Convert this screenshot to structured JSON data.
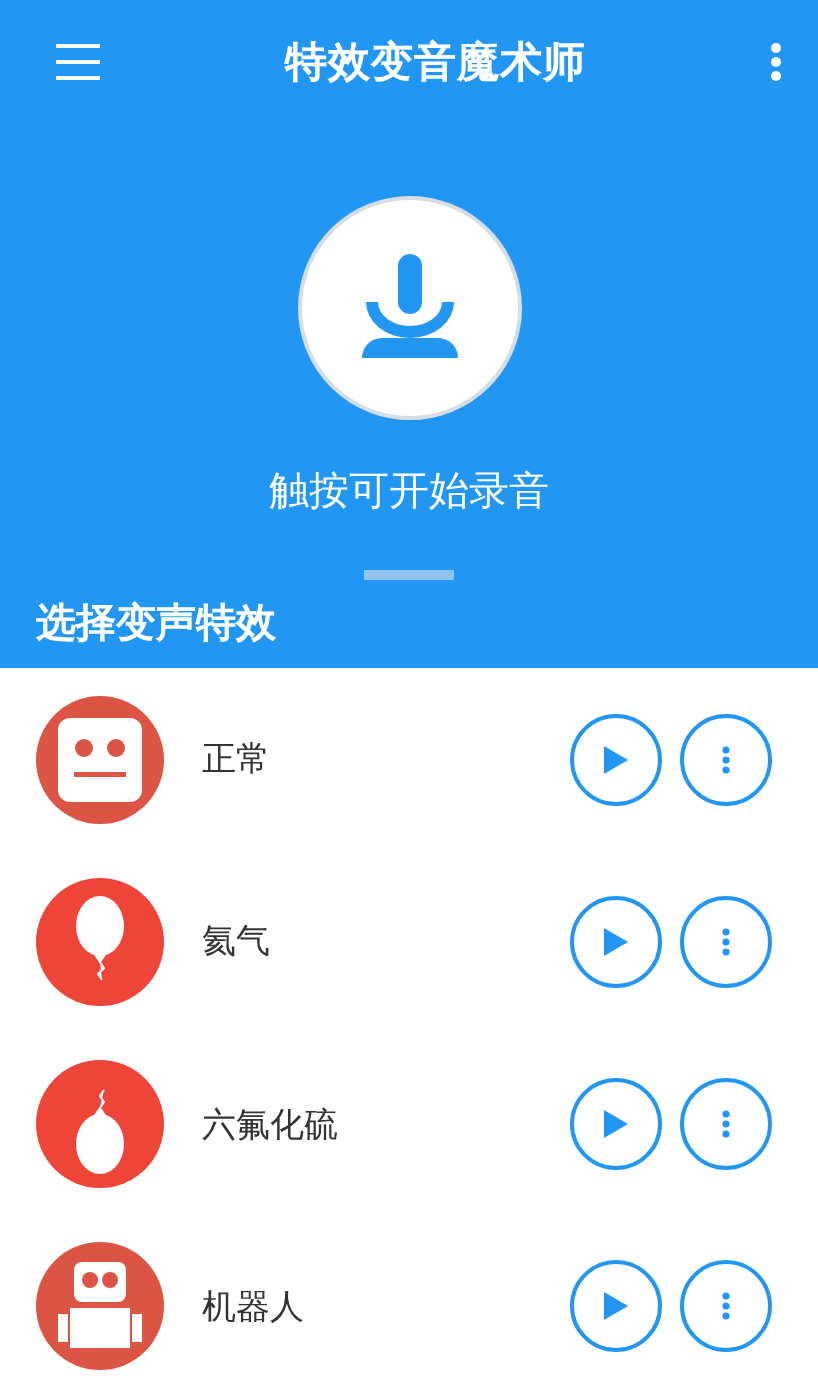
{
  "app_bar": {
    "title": "特效变音魔术师"
  },
  "recorder": {
    "caption": "触按可开始录音"
  },
  "section": {
    "title": "选择变声特效"
  },
  "effects": [
    {
      "name": "正常",
      "kind": "face"
    },
    {
      "name": "氦气",
      "kind": "balloon"
    },
    {
      "name": "六氟化硫",
      "kind": "weight"
    },
    {
      "name": "机器人",
      "kind": "robot"
    }
  ]
}
